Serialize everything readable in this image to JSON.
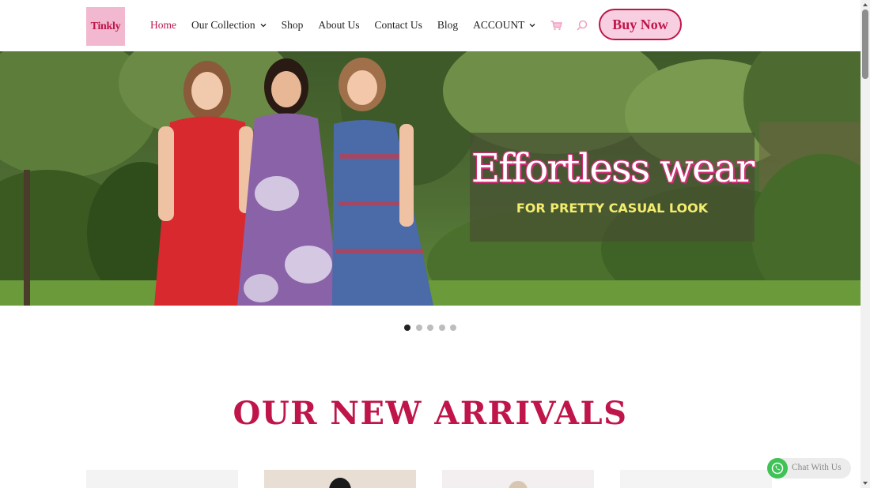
{
  "brand": {
    "logo_text": "Tinkly",
    "accent": "#c0154a",
    "logo_bg": "#f2b8cf"
  },
  "nav": {
    "items": [
      {
        "label": "Home",
        "active": true
      },
      {
        "label": "Our Collection",
        "dropdown": true
      },
      {
        "label": "Shop"
      },
      {
        "label": "About Us"
      },
      {
        "label": "Contact Us"
      },
      {
        "label": "Blog"
      },
      {
        "label": "ACCOUNT",
        "dropdown": true
      }
    ],
    "icons": [
      "cart-icon",
      "search-icon"
    ],
    "buy_now_label": "Buy Now"
  },
  "hero": {
    "title": "Effortless wear",
    "subtitle": "FOR PRETTY CASUAL LOOK",
    "slides_count": 5,
    "active_slide": 1
  },
  "section": {
    "title": "OUR NEW ARRIVALS"
  },
  "chat": {
    "label": "Chat With Us",
    "icon": "whatsapp-icon"
  }
}
